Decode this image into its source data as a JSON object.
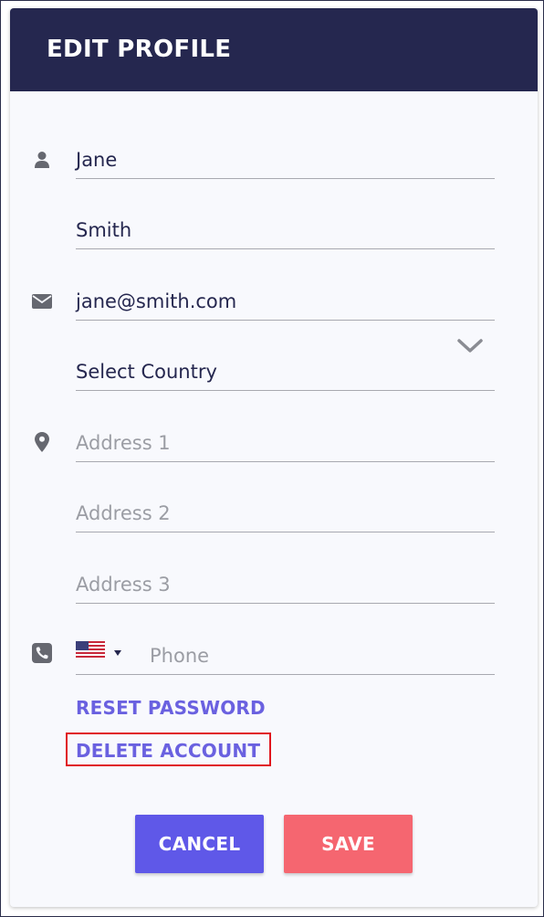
{
  "header": {
    "title": "EDIT PROFILE"
  },
  "form": {
    "first_name": {
      "value": "Jane"
    },
    "last_name": {
      "value": "Smith"
    },
    "email": {
      "value": "jane@smith.com"
    },
    "country": {
      "selected": "Select Country"
    },
    "address1": {
      "placeholder": "Address 1"
    },
    "address2": {
      "placeholder": "Address 2"
    },
    "address3": {
      "placeholder": "Address 3"
    },
    "phone": {
      "placeholder": "Phone",
      "country_flag": "us-flag-icon"
    }
  },
  "links": {
    "reset_password": "RESET PASSWORD",
    "delete_account": "DELETE ACCOUNT"
  },
  "buttons": {
    "cancel": "CANCEL",
    "save": "SAVE"
  },
  "icons": {
    "name": "user-icon",
    "email": "envelope-icon",
    "address": "map-pin-icon",
    "phone": "phone-icon",
    "country_dropdown": "chevron-down-icon"
  },
  "colors": {
    "header_bg": "#25274f",
    "link": "#6a61e0",
    "cancel_bg": "#5f58e8",
    "save_bg": "#f56670",
    "highlight_border": "#e0161e"
  }
}
